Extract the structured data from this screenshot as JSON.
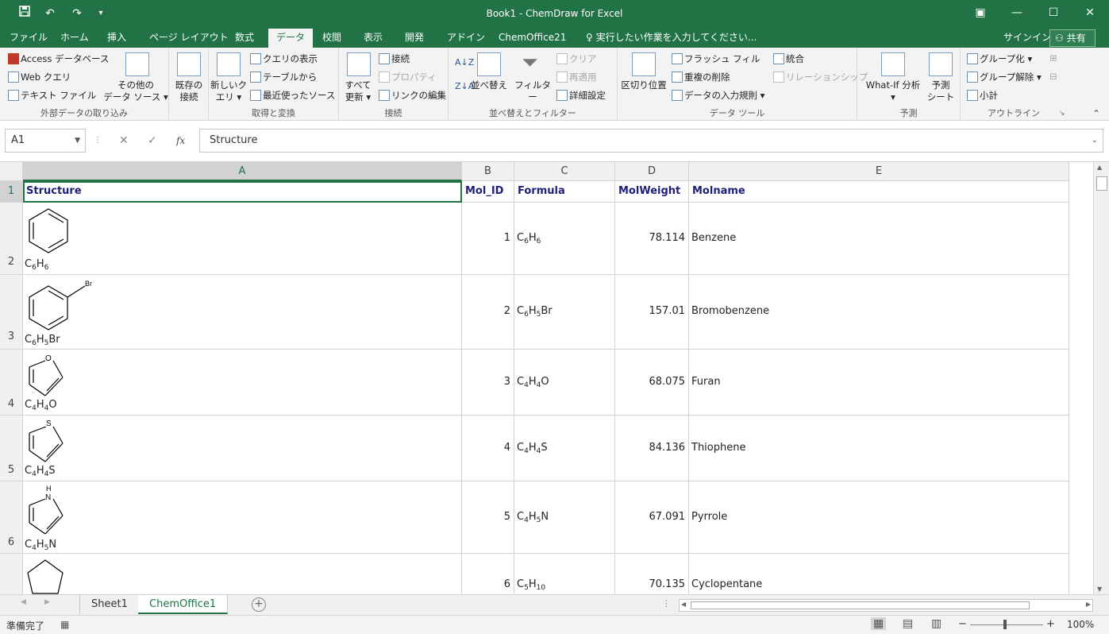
{
  "window": {
    "title": "Book1 - ChemDraw for Excel",
    "undo_icon": "undo-icon",
    "redo_icon": "redo-icon"
  },
  "tabs": [
    "ファイル",
    "ホーム",
    "挿入",
    "ページ レイアウト",
    "数式",
    "データ",
    "校閲",
    "表示",
    "開発",
    "アドイン",
    "ChemOffice21"
  ],
  "tell_me": "実行したい作業を入力してください...",
  "signin": "サインイン",
  "share": "共有",
  "ribbon": {
    "g1": {
      "label": "外部データの取り込み",
      "access": "Access データベース",
      "web": "Web クエリ",
      "text": "テキスト ファイル",
      "other1": "その他の",
      "other2": "データ ソース ▾",
      "existing1": "既存の",
      "existing2": "接続"
    },
    "g2": {
      "label": "取得と変換",
      "newq1": "新しいク",
      "newq2": "エリ ▾",
      "showq": "クエリの表示",
      "fromtable": "テーブルから",
      "recent": "最近使ったソース"
    },
    "g3": {
      "label": "接続",
      "refresh1": "すべて",
      "refresh2": "更新 ▾",
      "conn": "接続",
      "props": "プロパティ",
      "editlinks": "リンクの編集"
    },
    "g4": {
      "label": "並べ替えとフィルター",
      "sort": "並べ替え",
      "filter": "フィルター",
      "clear": "クリア",
      "reapply": "再適用",
      "advanced": "詳細設定"
    },
    "g5": {
      "label": "データ ツール",
      "split": "区切り位置",
      "flash": "フラッシュ フィル",
      "dedupe": "重複の削除",
      "validate": "データの入力規則",
      "consolidate": "統合",
      "relations": "リレーションシップ"
    },
    "g6": {
      "label": "予測",
      "whatif": "What-If 分析",
      "whatif2": "▾",
      "forecast1": "予測",
      "forecast2": "シート"
    },
    "g7": {
      "label": "アウトライン",
      "group": "グループ化",
      "ungroup": "グループ解除",
      "subtotal": "小計"
    }
  },
  "formula_bar": {
    "name_box": "A1",
    "cancel": "✕",
    "enter": "✓",
    "fx": "fx",
    "value": "Structure"
  },
  "columns": [
    "A",
    "B",
    "C",
    "D",
    "E"
  ],
  "header_row": {
    "row": "1",
    "cells": [
      "Structure",
      "Mol_ID",
      "Formula",
      "MolWeight",
      "Molname"
    ]
  },
  "rows": [
    {
      "row": "2",
      "struct_label": "C6H6",
      "mol_id": "1",
      "formula": "C6H6",
      "weight": "78.114",
      "name": "Benzene"
    },
    {
      "row": "3",
      "struct_label": "C6H5Br",
      "mol_id": "2",
      "formula": "C6H5Br",
      "weight": "157.01",
      "name": "Bromobenzene",
      "atom": "Br"
    },
    {
      "row": "4",
      "struct_label": "C4H4O",
      "mol_id": "3",
      "formula": "C4H4O",
      "weight": "68.075",
      "name": "Furan",
      "atom": "O"
    },
    {
      "row": "5",
      "struct_label": "C4H4S",
      "mol_id": "4",
      "formula": "C4H4S",
      "weight": "84.136",
      "name": "Thiophene",
      "atom": "S"
    },
    {
      "row": "6",
      "struct_label": "C4H5N",
      "mol_id": "5",
      "formula": "C4H5N",
      "weight": "67.091",
      "name": "Pyrrole",
      "atom": "N",
      "atom2": "H"
    },
    {
      "row": "7",
      "struct_label": "",
      "mol_id": "6",
      "formula": "C5H10",
      "weight": "70.135",
      "name": "Cyclopentane"
    }
  ],
  "sheets": [
    "Sheet1",
    "ChemOffice1"
  ],
  "status": {
    "ready": "準備完了",
    "zoom": "100%",
    "zoom_minus": "−",
    "zoom_plus": "+"
  }
}
